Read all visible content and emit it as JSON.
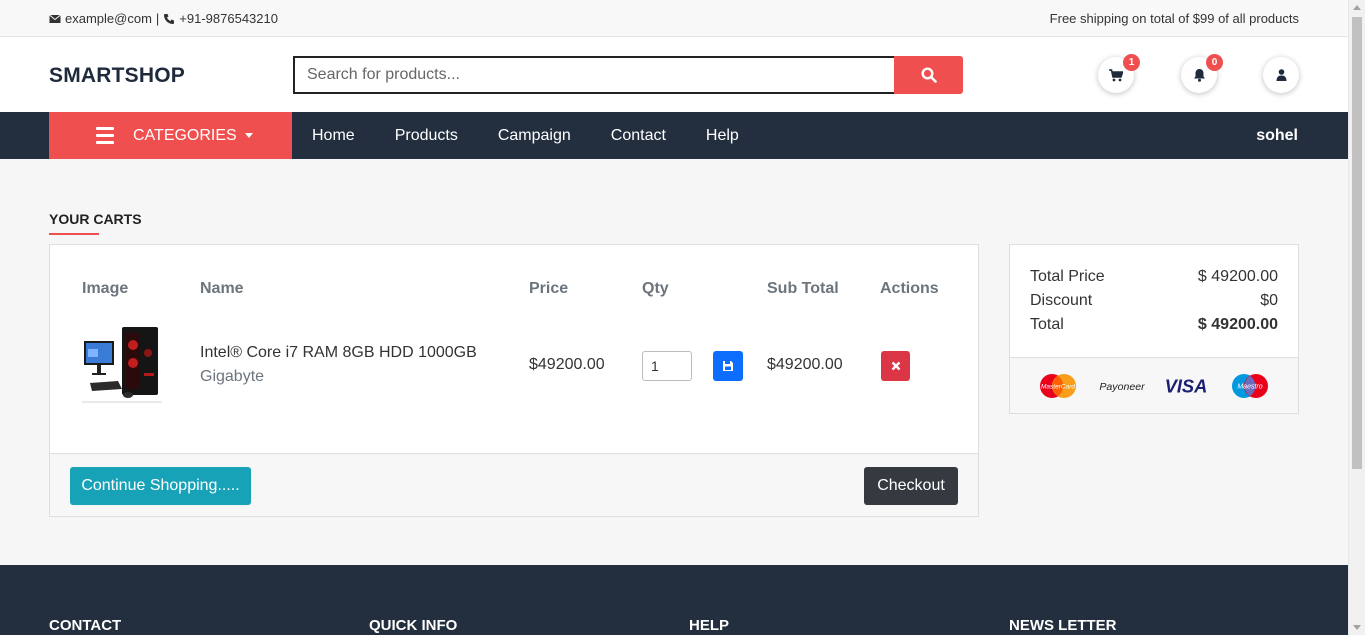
{
  "topbar": {
    "email": "example@com",
    "separator": "|",
    "phone": "+91-9876543210",
    "shipping_note": "Free shipping on total of $99 of all products"
  },
  "header": {
    "logo": "SMARTSHOP",
    "search_placeholder": "Search for products...",
    "cart_count": "1",
    "notification_count": "0"
  },
  "nav": {
    "categories_label": "CATEGORIES",
    "links": [
      "Home",
      "Products",
      "Campaign",
      "Contact",
      "Help"
    ],
    "user": "sohel"
  },
  "cart": {
    "title": "YOUR CARTS",
    "columns": [
      "Image",
      "Name",
      "Price",
      "Qty",
      "Sub Total",
      "Actions"
    ],
    "items": [
      {
        "name": "Intel® Core i7 RAM 8GB HDD 1000GB",
        "brand": "Gigabyte",
        "price": "$49200.00",
        "qty": "1",
        "subtotal": "$49200.00"
      }
    ],
    "continue_label": "Continue Shopping.....",
    "checkout_label": "Checkout"
  },
  "summary": {
    "total_price_label": "Total Price",
    "total_price": "$ 49200.00",
    "discount_label": "Discount",
    "discount": "$0",
    "total_label": "Total",
    "total": "$ 49200.00",
    "payment_methods": [
      "MasterCard",
      "Payoneer",
      "VISA",
      "Maestro"
    ]
  },
  "footer": {
    "headings": [
      "CONTACT",
      "QUICK INFO",
      "HELP",
      "NEWS LETTER"
    ]
  },
  "colors": {
    "accent": "#ef4f4f",
    "navbar": "#232f3e",
    "continue": "#17a2b8",
    "checkout": "#343a40",
    "save": "#0d6efd",
    "delete": "#dc3545"
  }
}
